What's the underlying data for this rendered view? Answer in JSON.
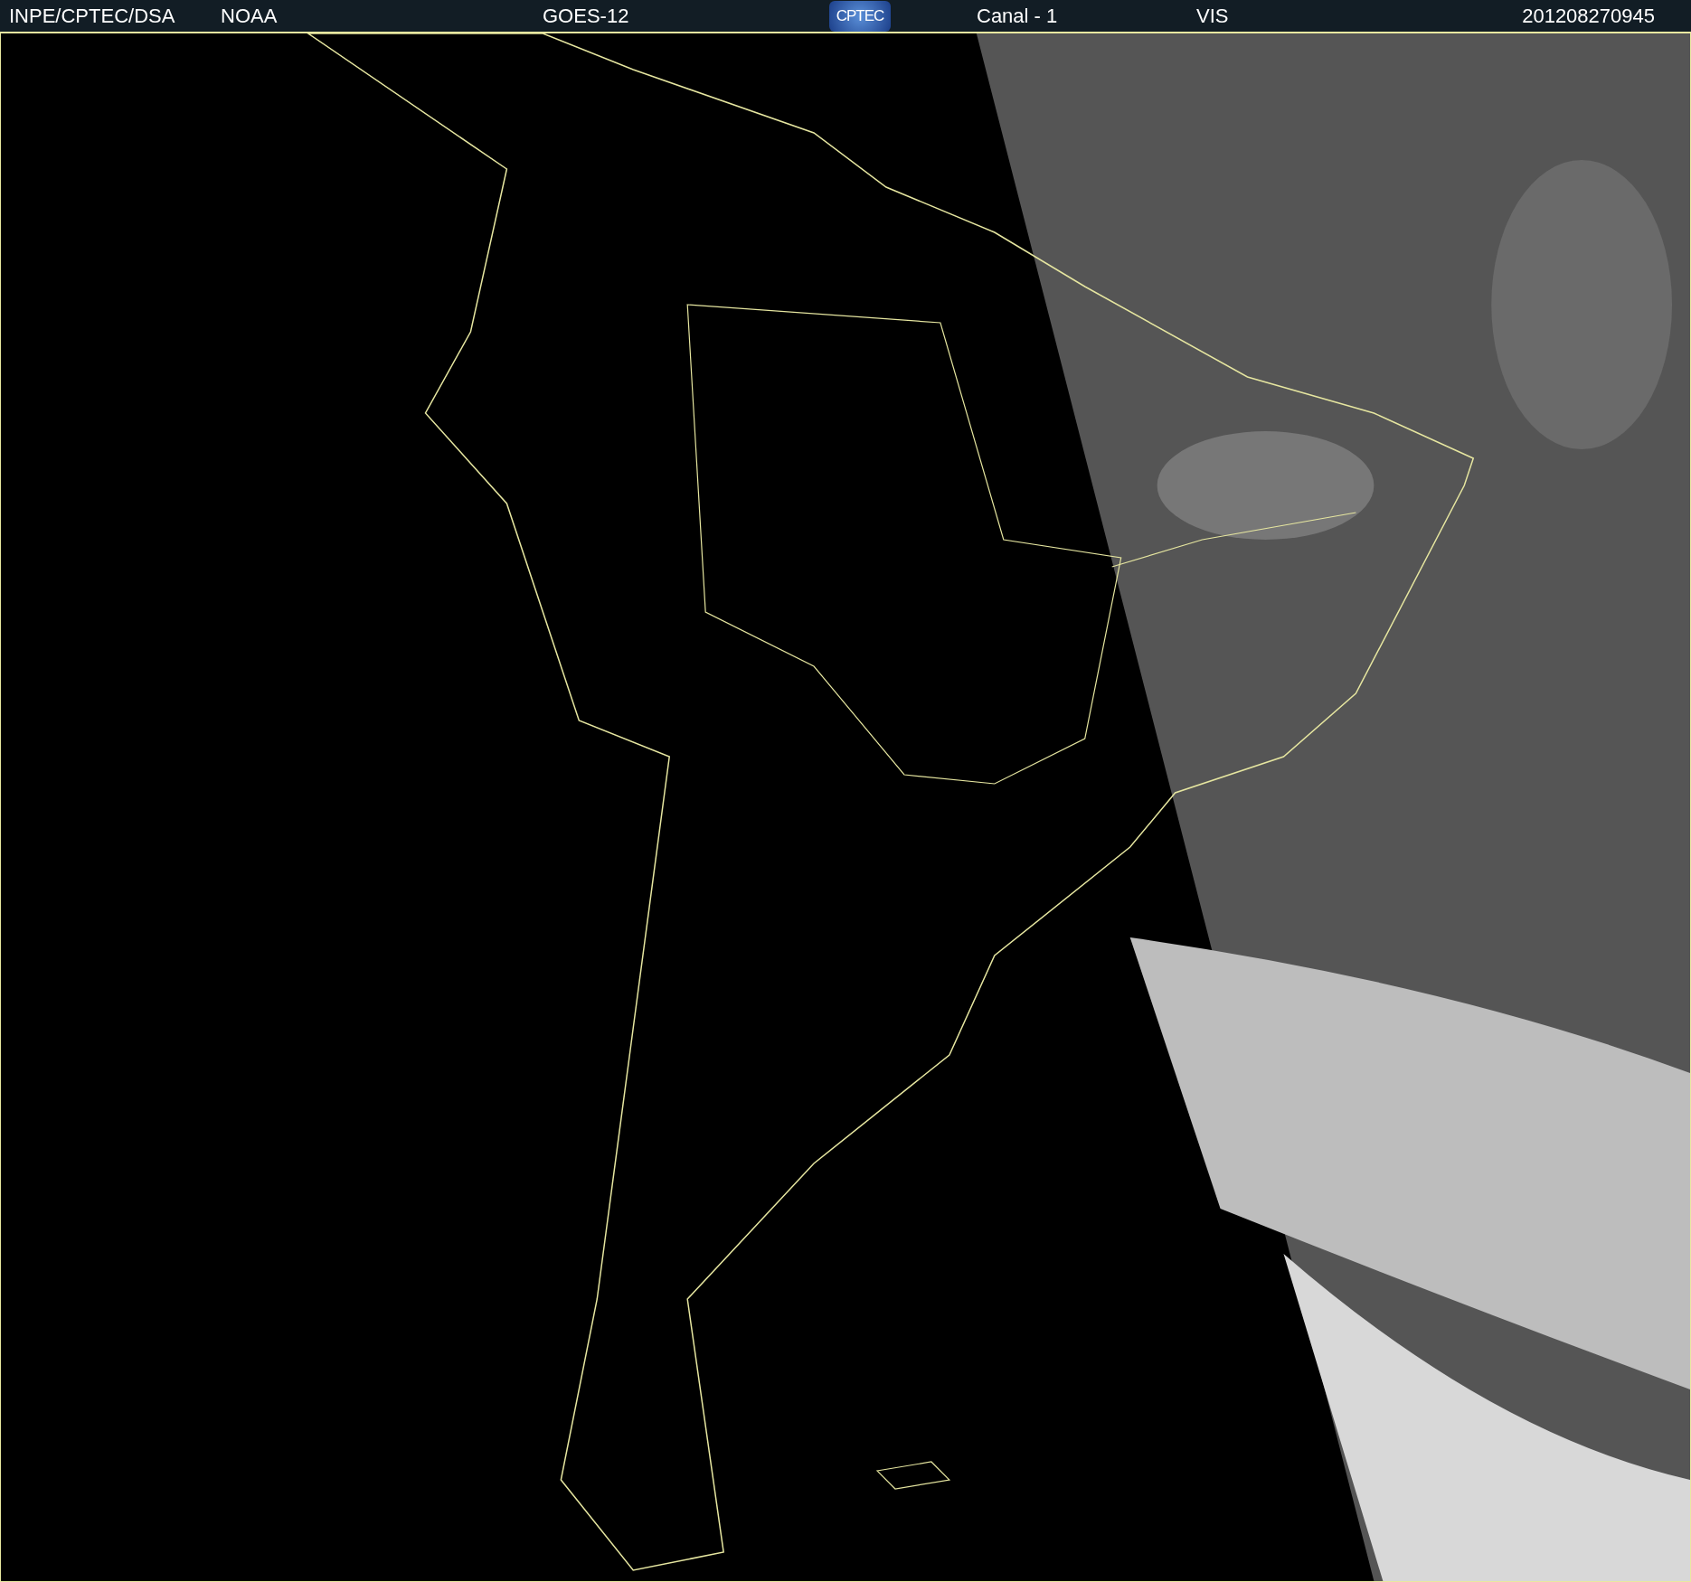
{
  "header": {
    "source": "INPE/CPTEC/DSA",
    "agency": "NOAA",
    "satellite": "GOES-12",
    "logo_text": "CPTEC",
    "channel": "Canal - 1",
    "band": "VIS",
    "timestamp": "201208270945"
  }
}
